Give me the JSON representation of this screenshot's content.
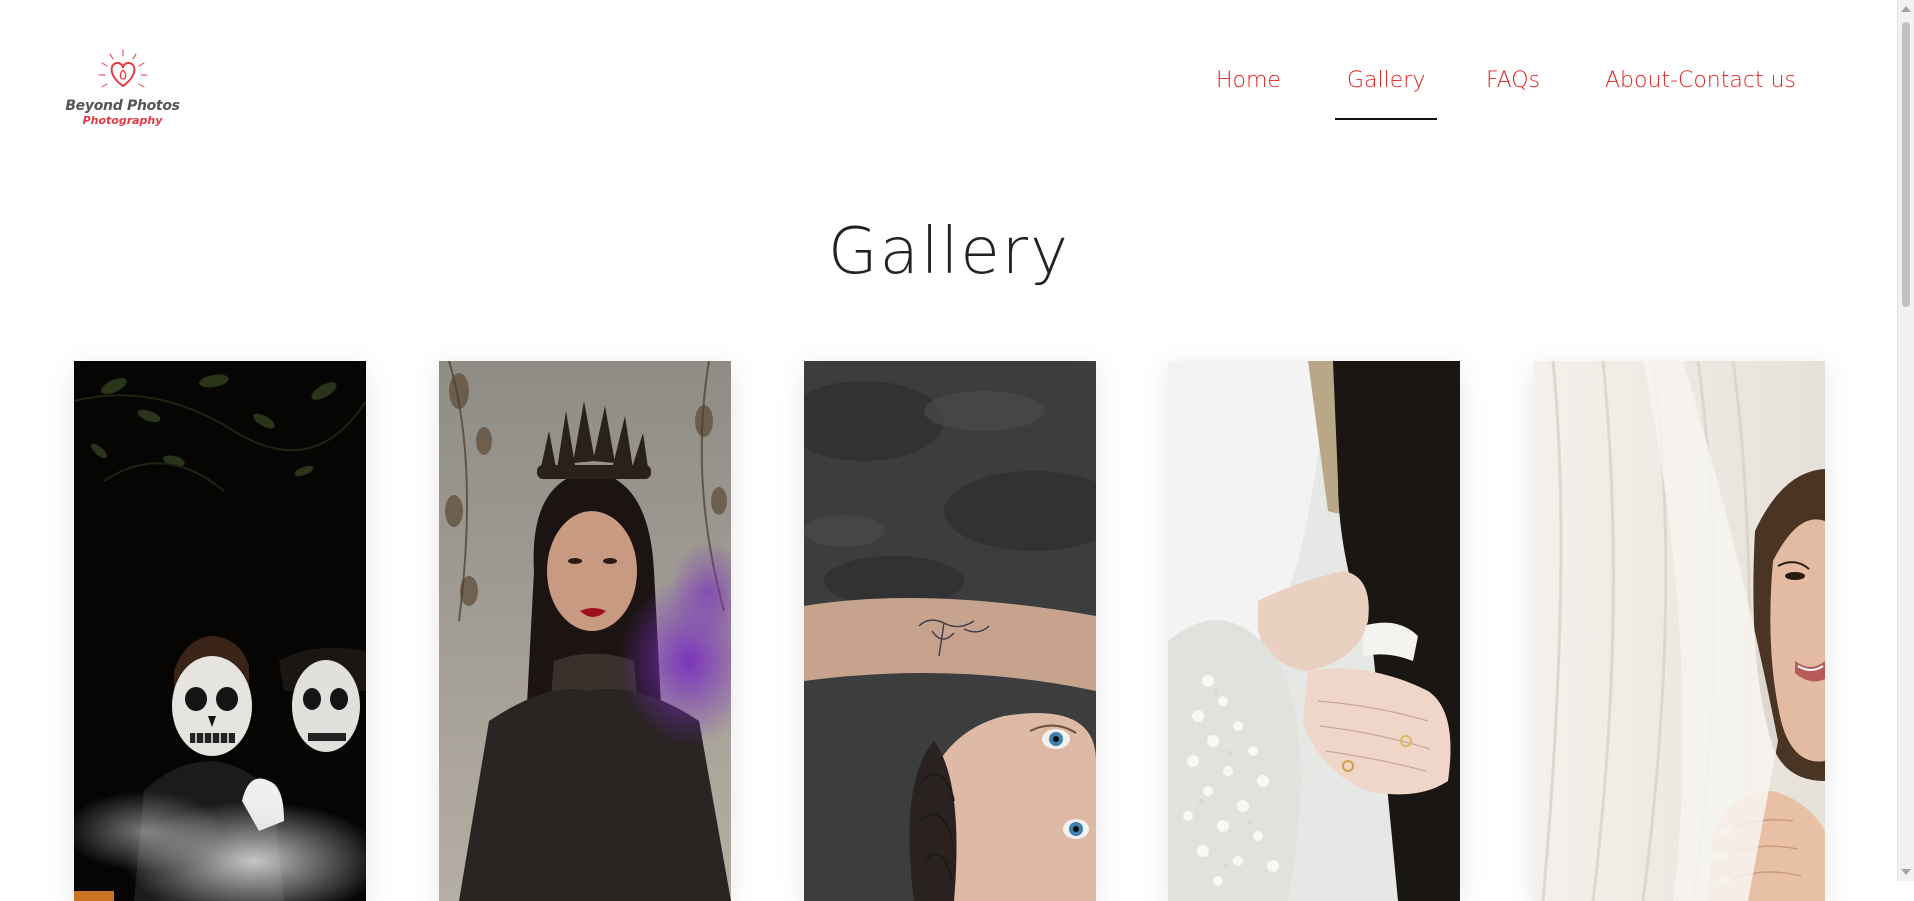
{
  "brand": {
    "name": "Beyond Photos",
    "tagline": "Photography",
    "accent_color": "#e63946"
  },
  "nav": {
    "items": [
      {
        "label": "Home"
      },
      {
        "label": "Gallery",
        "active": true
      },
      {
        "label": "FAQs"
      },
      {
        "label": "About-Contact us"
      }
    ],
    "link_color": "#e02020"
  },
  "page": {
    "title": "Gallery"
  },
  "gallery": {
    "photos": [
      {
        "subject": "skull-face-paint-portrait"
      },
      {
        "subject": "woman-with-crown-purple-smoke"
      },
      {
        "subject": "woman-lying-with-tattooed-arm"
      },
      {
        "subject": "wedding-hands-with-rings-and-bouquet"
      },
      {
        "subject": "bride-smiling-behind-veil"
      }
    ]
  }
}
